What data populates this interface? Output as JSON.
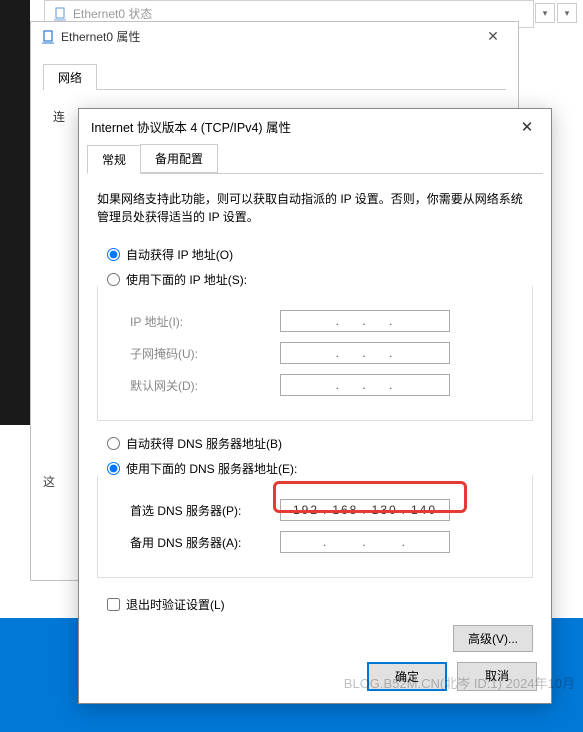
{
  "watermark": "BLOG.B52M.CN(北岑 ID:1)  2024年10月",
  "win1": {
    "title": "Ethernet0 状态"
  },
  "win2": {
    "title": "Ethernet0 属性",
    "tab": "网络",
    "label_prefix": "连",
    "section": "这"
  },
  "win3": {
    "title": "Internet 协议版本 4 (TCP/IPv4) 属性",
    "tabs": {
      "general": "常规",
      "alt": "备用配置"
    },
    "desc": "如果网络支持此功能，则可以获取自动指派的 IP 设置。否则，你需要从网络系统管理员处获得适当的 IP 设置。",
    "ip": {
      "auto": "自动获得 IP 地址(O)",
      "manual": "使用下面的 IP 地址(S):",
      "addr_label": "IP 地址(I):",
      "mask_label": "子网掩码(U):",
      "gw_label": "默认网关(D):"
    },
    "dns": {
      "auto": "自动获得 DNS 服务器地址(B)",
      "manual": "使用下面的 DNS 服务器地址(E):",
      "pref_label": "首选 DNS 服务器(P):",
      "alt_label": "备用 DNS 服务器(A):",
      "pref_value": {
        "a": "192",
        "b": "168",
        "c": "130",
        "d": "140"
      }
    },
    "validate": "退出时验证设置(L)",
    "advanced": "高级(V)...",
    "ok": "确定",
    "cancel": "取消"
  }
}
